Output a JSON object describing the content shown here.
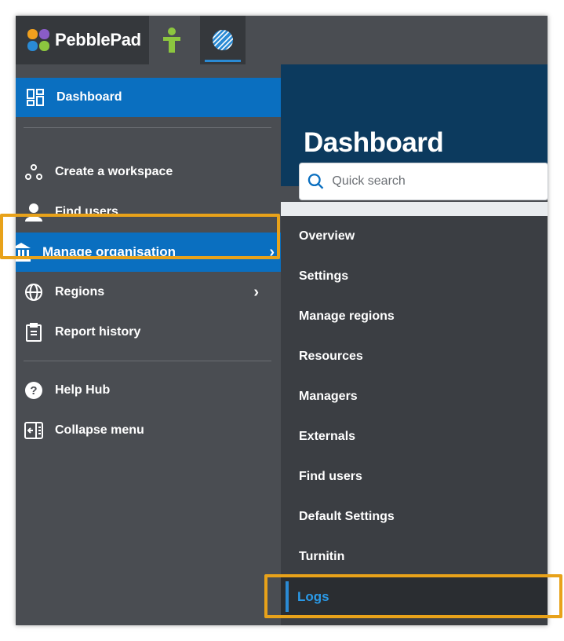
{
  "brand": {
    "name": "PebblePad"
  },
  "top_tabs": [
    {
      "name": "atlas",
      "icon": "user-figure-icon"
    },
    {
      "name": "atlas-workspace",
      "icon": "globe-striped-icon",
      "active": true
    }
  ],
  "sidebar": {
    "items": [
      {
        "label": "Dashboard",
        "icon": "dashboard-icon",
        "active": true
      },
      {
        "label": "Create a workspace",
        "icon": "workspace-icon"
      },
      {
        "label": "Find users",
        "icon": "user-icon"
      },
      {
        "label": "Manage organisation",
        "icon": "institution-icon",
        "highlighted": true,
        "chevron": "›"
      },
      {
        "label": "Regions",
        "icon": "globe-icon",
        "chevron": "›"
      },
      {
        "label": "Report history",
        "icon": "clipboard-icon"
      },
      {
        "label": "Help Hub",
        "icon": "help-icon"
      },
      {
        "label": "Collapse menu",
        "icon": "collapse-icon"
      }
    ]
  },
  "main": {
    "title": "Dashboard",
    "search": {
      "placeholder": "Quick search",
      "value": ""
    }
  },
  "submenu": {
    "items": [
      {
        "label": "Overview"
      },
      {
        "label": "Settings"
      },
      {
        "label": "Manage regions"
      },
      {
        "label": "Resources"
      },
      {
        "label": "Managers"
      },
      {
        "label": "Externals"
      },
      {
        "label": "Find users"
      },
      {
        "label": "Default Settings"
      },
      {
        "label": "Turnitin"
      },
      {
        "label": "Logs",
        "active": true
      }
    ]
  },
  "colors": {
    "accent": "#0a6fc0",
    "highlight": "#e8a21a",
    "sidebar": "#4a4d52",
    "submenu": "#3b3e43",
    "header": "#0c3a5e"
  }
}
